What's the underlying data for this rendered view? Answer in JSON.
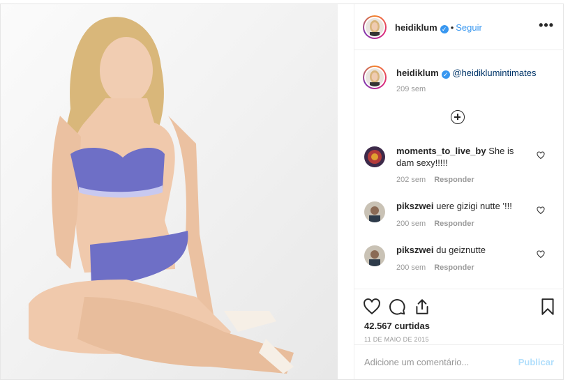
{
  "post": {
    "username": "heidiklum",
    "verified_mark": "✓",
    "follow_label": "Seguir",
    "separator": "•",
    "more_label": "•••"
  },
  "caption": {
    "username": "heidiklum",
    "mention": "@heidiklumintimates",
    "time": "209 sem"
  },
  "load_more_icon": "plus-circle-icon",
  "comments": [
    {
      "username": "moments_to_live_by",
      "text": "She is dam sexy!!!!!",
      "time": "202 sem",
      "reply": "Responder"
    },
    {
      "username": "pikszwei",
      "text": "uere gizigi nutte '!!!",
      "time": "200 sem",
      "reply": "Responder"
    },
    {
      "username": "pikszwei",
      "text": "du geiznutte",
      "time": "200 sem",
      "reply": "Responder"
    }
  ],
  "actions": {
    "icons": [
      "heart-icon",
      "comment-icon",
      "share-icon",
      "bookmark-icon"
    ],
    "likes": "42.567 curtidas",
    "date": "11 DE MAIO DE 2015"
  },
  "add_comment": {
    "placeholder": "Adicione um comentário...",
    "publish": "Publicar"
  },
  "colors": {
    "accent": "#3897f0",
    "muted": "#999999",
    "publish_disabled": "#b2dffc"
  }
}
